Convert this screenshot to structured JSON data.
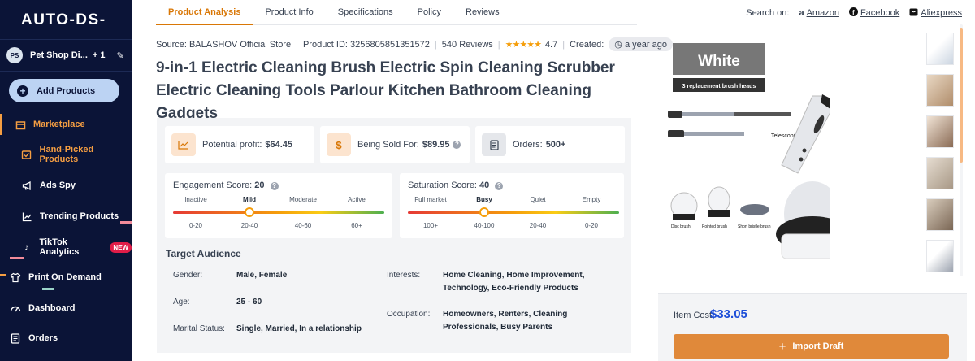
{
  "sidebar": {
    "logo": "AUTO-DS-",
    "store": {
      "initials": "PS",
      "name": "Pet Shop Di...",
      "extra": "+ 1"
    },
    "add_products": "Add Products",
    "items": [
      {
        "label": "Marketplace",
        "icon": "store-icon"
      },
      {
        "label": "Hand-Picked Products",
        "icon": "hand-picked-icon"
      },
      {
        "label": "Ads Spy",
        "icon": "megaphone-icon"
      },
      {
        "label": "Trending Products",
        "icon": "trending-icon"
      },
      {
        "label": "TikTok Analytics",
        "icon": "tiktok-icon",
        "badge": "NEW"
      },
      {
        "label": "Print On Demand",
        "icon": "shirt-icon"
      },
      {
        "label": "Dashboard",
        "icon": "gauge-icon"
      },
      {
        "label": "Orders",
        "icon": "orders-icon"
      }
    ]
  },
  "tabs": [
    "Product Analysis",
    "Product Info",
    "Specifications",
    "Policy",
    "Reviews"
  ],
  "search_on": {
    "label": "Search on:",
    "amazon": "Amazon",
    "facebook": "Facebook",
    "aliexpress": "Aliexpress"
  },
  "meta": {
    "source": "Source: BALASHOV Official Store",
    "product_id": "Product ID: 3256805851351572",
    "reviews": "540 Reviews",
    "rating": "4.7",
    "created_label": "Created:",
    "created_value": "a year ago"
  },
  "title": "9-in-1 Electric Cleaning Brush Electric Spin Cleaning Scrubber Electric Cleaning Tools Parlour Kitchen Bathroom Cleaning Gadgets",
  "stats": {
    "profit_label": "Potential profit:",
    "profit_value": "$64.45",
    "sold_label": "Being Sold For:",
    "sold_value": "$89.95",
    "orders_label": "Orders:",
    "orders_value": "500+"
  },
  "engagement": {
    "label": "Engagement Score:",
    "value": "20",
    "levels": [
      "Inactive",
      "Mild",
      "Moderate",
      "Active"
    ],
    "ranges": [
      "0-20",
      "20-40",
      "40-60",
      "60+"
    ],
    "selected_index": 1
  },
  "saturation": {
    "label": "Saturation Score:",
    "value": "40",
    "levels": [
      "Full market",
      "Busy",
      "Quiet",
      "Empty"
    ],
    "ranges": [
      "100+",
      "40-100",
      "20-40",
      "0-20"
    ],
    "selected_index": 1
  },
  "target_audience": {
    "title": "Target Audience",
    "gender_label": "Gender:",
    "gender": "Male, Female",
    "age_label": "Age:",
    "age": "25 - 60",
    "marital_label": "Marital Status:",
    "marital": "Single, Married, In a relationship",
    "interests_label": "Interests:",
    "interests_line1": "Home Cleaning, Home Improvement,",
    "interests_line2": "Technology, Eco-Friendly Products",
    "occupation_label": "Occupation:",
    "occupation_line1": "Homeowners, Renters, Cleaning",
    "occupation_line2": "Professionals, Busy Parents"
  },
  "product_image": {
    "color_tag": "White",
    "subtitle": "3 replacement brush heads",
    "rod_label": "Telescopic rod",
    "brush_labels": [
      "Disc brush",
      "Pointed brush",
      "Short bristle brush"
    ]
  },
  "item_cost": {
    "label": "Item Cost",
    "value": "$33.05"
  },
  "import_button": "Import Draft",
  "colors": {
    "accent": "#e0893a",
    "sidebar": "#0b1437",
    "price": "#1d4ed8"
  }
}
